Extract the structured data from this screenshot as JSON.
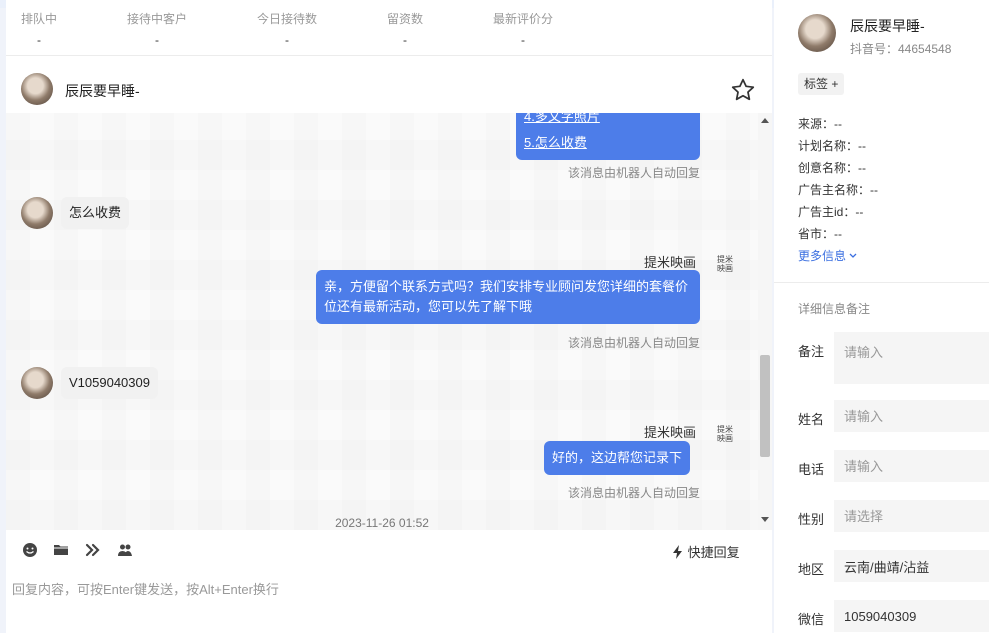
{
  "stats": [
    {
      "label": "排队中",
      "value": "-"
    },
    {
      "label": "接待中客户",
      "value": "-"
    },
    {
      "label": "今日接待数",
      "value": "-"
    },
    {
      "label": "留资数",
      "value": "-"
    },
    {
      "label": "最新评价分",
      "value": "-"
    }
  ],
  "chat": {
    "contact_name": "辰辰要早睡-",
    "messages": {
      "m1_partial": "4.多文字照片",
      "m1_link": "5.怎么收费",
      "auto_note": "该消息由机器人自动回复",
      "m2": "怎么收费",
      "sender": "提米映画",
      "brand_logo": "提米映画",
      "m3": "亲，方便留个联系方式吗？我们安排专业顾问发您详细的套餐价位还有最新活动，您可以先了解下哦",
      "m4": "V1059040309",
      "m5": "好的，这边帮您记录下"
    },
    "timestamp": "2023-11-26 01:52"
  },
  "composer": {
    "quick_reply": "快捷回复",
    "placeholder": "回复内容，可按Enter键发送，按Alt+Enter换行"
  },
  "profile": {
    "name": "辰辰要早睡-",
    "id_text": "抖音号：44654548",
    "tag_label": "标签 +",
    "info": [
      "来源：--",
      "计划名称：--",
      "创意名称：--",
      "广告主名称：--",
      "广告主id：--",
      "省市：--"
    ],
    "more_label": "更多信息",
    "section_title": "详细信息备注",
    "fields": {
      "note_label": "备注",
      "note_placeholder": "请输入",
      "name_label": "姓名",
      "name_placeholder": "请输入",
      "phone_label": "电话",
      "phone_placeholder": "请输入",
      "gender_label": "性别",
      "gender_placeholder": "请选择",
      "region_label": "地区",
      "region_value": "云南/曲靖/沾益",
      "wechat_label": "微信",
      "wechat_value": "1059040309"
    }
  },
  "colors": {
    "accent": "#4d7de9",
    "link": "#3b6fe0"
  }
}
